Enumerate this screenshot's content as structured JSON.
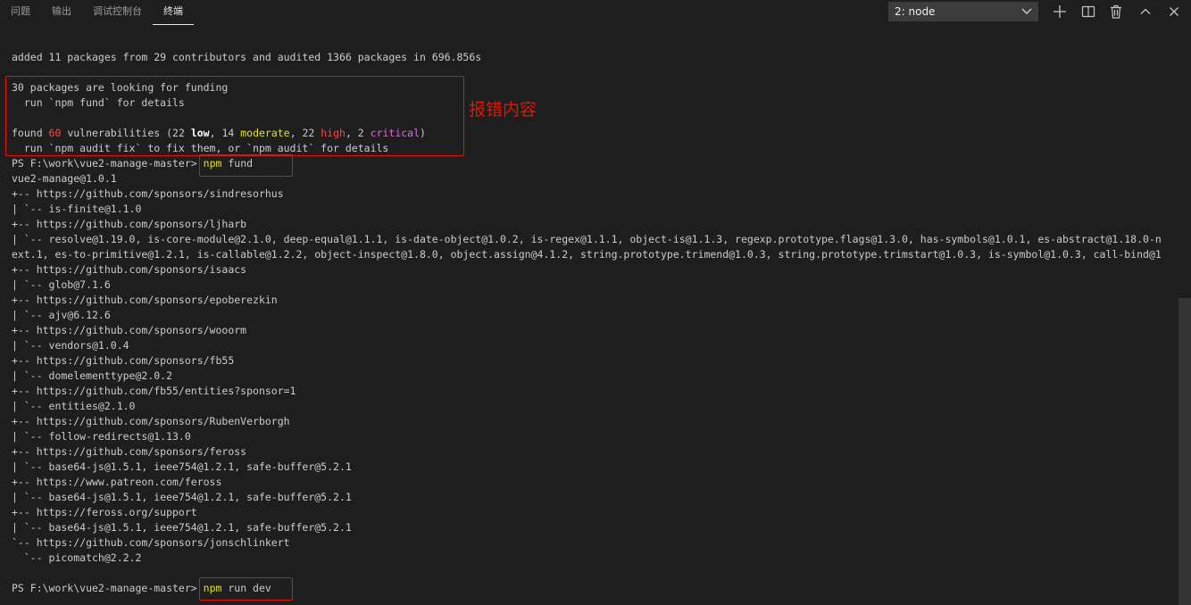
{
  "tabs": [
    {
      "label": "问题"
    },
    {
      "label": "输出"
    },
    {
      "label": "调试控制台"
    },
    {
      "label": "终端"
    }
  ],
  "terminal_select": {
    "value": "2: node"
  },
  "icons": {
    "add": "plus-icon",
    "split": "split-icon",
    "trash": "trash-icon",
    "maximize": "chevron-up-icon",
    "close": "close-icon"
  },
  "annotation": "报错内容",
  "lines": [
    "added 11 packages from 29 contributors and audited 1366 packages in 696.856s",
    "30 packages are looking for funding",
    "  run `npm fund` for details",
    "run_audit_line",
    "  run `npm audit fix` to fix them, or `npm audit` for details"
  ],
  "found": {
    "a": "found ",
    "count": "60",
    "b": " vulnerabilities (22 ",
    "low": "low",
    "c": ", 14 ",
    "moderate": "moderate",
    "d": ", 22 ",
    "high": "high",
    "e": ", 2 ",
    "critical": "critical",
    "f": ")"
  },
  "prompt": "PS F:\\work\\vue2-manage-master>",
  "cmd1": {
    "npm": "npm",
    "rest": " fund"
  },
  "cmd2": {
    "npm": "npm",
    "rest": " run dev"
  },
  "fund_output": [
    "vue2-manage@1.0.1",
    "+-- https://github.com/sponsors/sindresorhus",
    "| `-- is-finite@1.1.0",
    "+-- https://github.com/sponsors/ljharb",
    "| `-- resolve@1.19.0, is-core-module@2.1.0, deep-equal@1.1.1, is-date-object@1.0.2, is-regex@1.1.1, object-is@1.1.3, regexp.prototype.flags@1.3.0, has-symbols@1.0.1, es-abstract@1.18.0-n",
    "ext.1, es-to-primitive@1.2.1, is-callable@1.2.2, object-inspect@1.8.0, object.assign@4.1.2, string.prototype.trimend@1.0.3, string.prototype.trimstart@1.0.3, is-symbol@1.0.3, call-bind@1",
    "+-- https://github.com/sponsors/isaacs",
    "| `-- glob@7.1.6",
    "+-- https://github.com/sponsors/epoberezkin",
    "| `-- ajv@6.12.6",
    "+-- https://github.com/sponsors/wooorm",
    "| `-- vendors@1.0.4",
    "+-- https://github.com/sponsors/fb55",
    "| `-- domelementtype@2.0.2",
    "+-- https://github.com/fb55/entities?sponsor=1",
    "| `-- entities@2.1.0",
    "+-- https://github.com/sponsors/RubenVerborgh",
    "| `-- follow-redirects@1.13.0",
    "+-- https://github.com/sponsors/feross",
    "| `-- base64-js@1.5.1, ieee754@1.2.1, safe-buffer@5.2.1",
    "+-- https://www.patreon.com/feross",
    "| `-- base64-js@1.5.1, ieee754@1.2.1, safe-buffer@5.2.1",
    "+-- https://feross.org/support",
    "| `-- base64-js@1.5.1, ieee754@1.2.1, safe-buffer@5.2.1",
    "`-- https://github.com/sponsors/jonschlinkert",
    "  `-- picomatch@2.2.2"
  ]
}
